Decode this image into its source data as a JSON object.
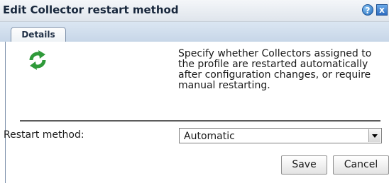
{
  "dialog": {
    "title": "Edit Collector restart method",
    "help_glyph": "?",
    "close_glyph": "x"
  },
  "tabs": [
    {
      "label": "Details",
      "selected": true
    }
  ],
  "details": {
    "icon": "refresh-icon",
    "description": "Specify whether Collectors assigned to the profile are restarted automatically after configuration changes, or require manual restarting.",
    "restart_method_label": "Restart method:",
    "restart_method_value": "Automatic"
  },
  "buttons": {
    "save_label": "Save",
    "cancel_label": "Cancel"
  },
  "colors": {
    "icon_green": "#2f9a3a",
    "title_text": "#17263b",
    "tab_border": "#7a8ea8"
  }
}
